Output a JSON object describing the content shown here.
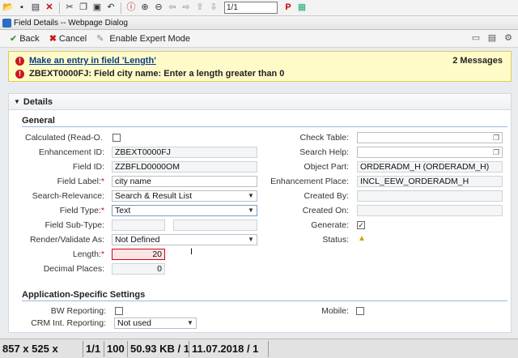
{
  "viewer_toolbar": {
    "page_value": "1/1",
    "icons": [
      "open-icon",
      "save-icon",
      "print-icon",
      "close-icon",
      "cut-icon",
      "copy-icon",
      "paste-icon",
      "undo-icon",
      "info-icon",
      "zoom-in-icon",
      "zoom-out-icon",
      "back-icon",
      "forward-icon",
      "up-icon",
      "down-icon",
      "p-icon",
      "image-icon"
    ]
  },
  "window": {
    "title": "Field Details -- Webpage Dialog"
  },
  "dialog_toolbar": {
    "back": "Back",
    "cancel": "Cancel",
    "expert_mode": "Enable Expert Mode"
  },
  "messages": {
    "count": "2 Messages",
    "items": [
      "Make an entry in field 'Length'",
      "ZBEXT0000FJ: Field city name: Enter a length greater than 0"
    ]
  },
  "details": {
    "title": "Details",
    "general": {
      "title": "General",
      "calculated_label": "Calculated (Read-O.",
      "enhancement_id_label": "Enhancement ID:",
      "enhancement_id": "ZBEXT0000FJ",
      "field_id_label": "Field ID:",
      "field_id": "ZZBFLD0000OM",
      "field_label_label": "Field Label:",
      "field_label": "city name",
      "search_relevance_label": "Search-Relevance:",
      "search_relevance": "Search & Result List",
      "field_type_label": "Field Type:",
      "field_type": "Text",
      "field_subtype_label": "Field Sub-Type:",
      "render_label": "Render/Validate As:",
      "render_value": "Not Defined",
      "length_label": "Length:",
      "length": "20",
      "decimal_label": "Decimal Places:",
      "decimal": "0",
      "check_table_label": "Check Table:",
      "search_help_label": "Search Help:",
      "object_part_label": "Object Part:",
      "object_part": "ORDERADM_H (ORDERADM_H)",
      "enh_place_label": "Enhancement Place:",
      "enh_place": "INCL_EEW_ORDERADM_H",
      "created_by_label": "Created By:",
      "created_on_label": "Created On:",
      "generate_label": "Generate:",
      "status_label": "Status:",
      "required_mark": "*"
    },
    "app_settings": {
      "title": "Application-Specific Settings",
      "bw_label": "BW Reporting:",
      "mobile_label": "Mobile:",
      "crm_label": "CRM Int. Reporting:",
      "crm_value": "Not used"
    }
  },
  "statusbar": {
    "cells": [
      "857 x 525 x",
      "1/1",
      "100 %",
      "50.93 KB / 1",
      "11.07.2018 / 1"
    ]
  },
  "colors": {
    "error_red": "#c9191d",
    "message_bg": "#fffbc8",
    "accent_blue": "#0b3c8c",
    "warning": "#d4a106"
  }
}
